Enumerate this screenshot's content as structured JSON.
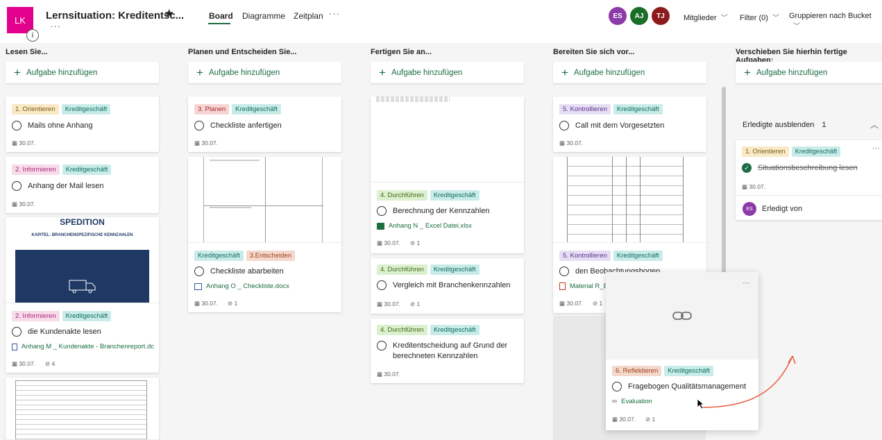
{
  "header": {
    "logo_initials": "LK",
    "info": "i",
    "plan_title": "Lernsituation: Kreditentsc...",
    "star": "★",
    "more": "···",
    "tabs": [
      "Board",
      "Diagramme",
      "Zeitplan"
    ],
    "tabs_more": "···",
    "avatars": [
      {
        "initials": "ES",
        "color": "#8b3ca8"
      },
      {
        "initials": "AJ",
        "color": "#1b6d2a"
      },
      {
        "initials": "TJ",
        "color": "#8e1b1b"
      }
    ],
    "members": "Mitglieder",
    "filter": "Filter (0)",
    "group": "Gruppieren nach Bucket"
  },
  "add_task_label": "Aufgabe hinzufügen",
  "columns": [
    {
      "title": "Lesen Sie..."
    },
    {
      "title": "Planen und Entscheiden Sie..."
    },
    {
      "title": "Fertigen Sie an..."
    },
    {
      "title": "Bereiten Sie sich vor..."
    },
    {
      "title": "Verschieben Sie hierhin fertige Aufgaben:"
    }
  ],
  "col1": {
    "c1": {
      "l1": "1. Orientieren",
      "l2": "Kreditgeschäft",
      "task": "Mails ohne Anhang",
      "date": "30.07."
    },
    "c2": {
      "l1": "2. Informieren",
      "l2": "Kreditgeschäft",
      "task": "Anhang der Mail lesen",
      "date": "30.07."
    },
    "c3": {
      "preview_title": "SPEDITION",
      "preview_sub": "KAPITEL: BRANCHENSPEZIFISCHE KENNZAHLEN",
      "l1": "2. Informieren",
      "l2": "Kreditgeschäft",
      "task": "die Kundenakte lesen",
      "attachment": "Anhang M _ Kundenakte - Branchenreport.dc",
      "date": "30.07.",
      "att_count": "4"
    }
  },
  "col2": {
    "c1": {
      "l1": "3. Planen",
      "l2": "Kreditgeschäft",
      "task": "Checkliste anfertigen",
      "date": "30.07."
    },
    "c2": {
      "l1": "Kreditgeschäft",
      "l2": "3.Entscheiden",
      "task": "Checkliste abarbeiten",
      "attachment": "Anhang O _ Checkliste.docx",
      "date": "30.07.",
      "att_count": "1"
    }
  },
  "col3": {
    "c1": {
      "l1": "4. Durchführen",
      "l2": "Kreditgeschäft",
      "task": "Berechnung der Kennzahlen",
      "attachment": "Anhang N _ Excel Datei.xlsx",
      "date": "30.07.",
      "att_count": "1"
    },
    "c2": {
      "l1": "4. Durchführen",
      "l2": "Kreditgeschäft",
      "task": "Vergleich mit Branchenkennzahlen",
      "date": "30.07.",
      "att_count": "1"
    },
    "c3": {
      "l1": "4. Durchführen",
      "l2": "Kreditgeschäft",
      "task": "Kreditentscheidung auf Grund der berechneten Kennzahlen",
      "date": "30.07."
    }
  },
  "col4": {
    "c1": {
      "l1": "5. Kontrollieren",
      "l2": "Kreditgeschäft",
      "task": "Call mit dem Vorgesetzten",
      "date": "30.07."
    },
    "c2": {
      "l1": "5. Kontrollieren",
      "l2": "Kreditgeschäft",
      "task": "den Beobachtungsbogen",
      "attachment": "Material R_Beobachtungsbogen.pdf",
      "date": "30.07.",
      "att_count": "1"
    }
  },
  "col5": {
    "hide_done": "Erledigte ausblenden",
    "done_count": "1",
    "c1": {
      "l1": "1. Orientieren",
      "l2": "Kreditgeschäft",
      "task": "Situationsbeschreibung lesen",
      "date": "30.07.",
      "done_by_initials": "ES",
      "done_by": "Erledigt von"
    }
  },
  "drag_card": {
    "l1": "6. Reflektieren",
    "l2": "Kreditgeschäft",
    "task": "Fragebogen Qualitätsmanagement",
    "link": "Evaluation",
    "date": "30.07.",
    "att_count": "1",
    "more": "···"
  }
}
